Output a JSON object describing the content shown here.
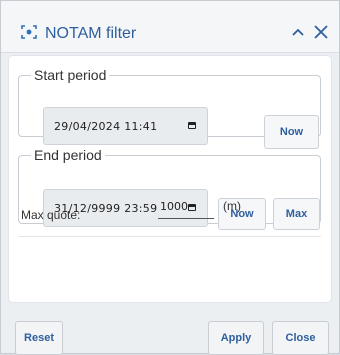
{
  "dialog": {
    "title": "NOTAM filter",
    "title_icon": "target-scan-icon",
    "collapse_icon": "chevron-up-icon",
    "close_icon": "close-icon",
    "accent_color": "#2f5f9e"
  },
  "start_period": {
    "legend": "Start period",
    "value": "29/04/2024 11:41",
    "now_label": "Now"
  },
  "end_period": {
    "legend": "End period",
    "value": "31/12/9999 23:59",
    "now_label": "Now",
    "max_label": "Max"
  },
  "max_quote": {
    "label": "Max quote:",
    "value": "1000",
    "unit": "(m)"
  },
  "footer": {
    "reset_label": "Reset",
    "apply_label": "Apply",
    "close_label": "Close"
  }
}
